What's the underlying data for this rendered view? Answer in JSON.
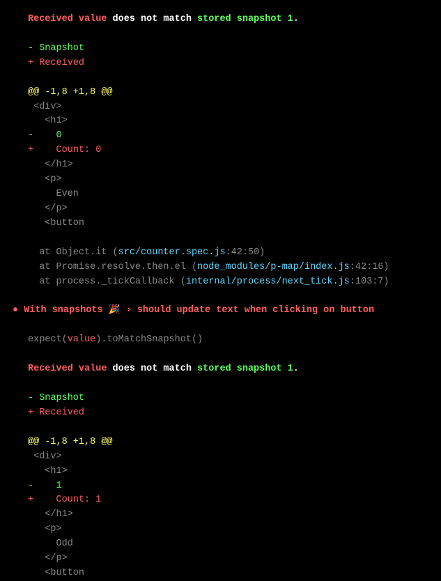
{
  "msg1": {
    "received_value": "Received value",
    "mid": " does not match ",
    "stored": "stored snapshot 1",
    "dot": "."
  },
  "legend": {
    "snap_prefix": "- ",
    "snap": "Snapshot",
    "recv_prefix": "+ ",
    "recv": "Received"
  },
  "hunk": "@@ -1,8 +1,8 @@",
  "diff1": {
    "l1": " <div>",
    "l2": "   <h1>",
    "minus": "-",
    "minus_val": "    0",
    "plus": "+",
    "plus_val": "    Count: 0",
    "l5": "   </h1>",
    "l6": "   <p>",
    "l7": "     Even",
    "l8": "   </p>",
    "l9": "   <button"
  },
  "stack1": {
    "at1a": "  at Object.it (",
    "at1b": "src/counter.spec.js",
    "at1c": ":42:50)",
    "at2a": "  at Promise.resolve.then.el (",
    "at2b": "node_modules/p-map/index.js",
    "at2c": ":42:16)",
    "at3a": "  at process._tickCallback (",
    "at3b": "internal/process/next_tick.js",
    "at3c": ":103:7)"
  },
  "test2": {
    "bullet": "● ",
    "title": "With snapshots 🎉 › should update text when clicking on button"
  },
  "expect": {
    "a": "expect(",
    "b": "value",
    "c": ").",
    "d": "toMatchSnapshot",
    "e": "()"
  },
  "diff2": {
    "l1": " <div>",
    "l2": "   <h1>",
    "minus": "-",
    "minus_val": "    1",
    "plus": "+",
    "plus_val": "    Count: 1",
    "l5": "   </h1>",
    "l6": "   <p>",
    "l7": "     Odd",
    "l8": "   </p>",
    "l9": "   <button"
  }
}
